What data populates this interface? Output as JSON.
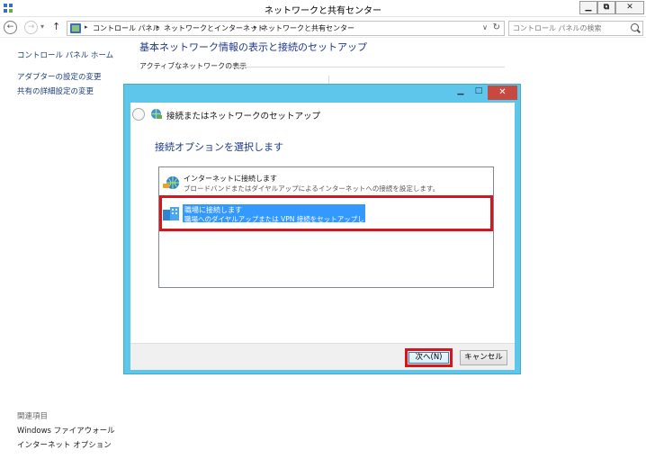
{
  "window": {
    "title": "ネットワークと共有センター",
    "min_glyph": "▁",
    "max_glyph": "⧉",
    "close_glyph": "✕"
  },
  "address": {
    "back_glyph": "←",
    "fwd_glyph": "→",
    "drop_glyph": "▾",
    "up_glyph": "↑",
    "breadcrumbs": [
      "コントロール パネル",
      "ネットワークとインターネット",
      "ネットワークと共有センター"
    ],
    "sep_glyph": "▸",
    "dropdown_glyph": "∨",
    "refresh_glyph": "↻",
    "search_placeholder": "コントロール パネルの検索"
  },
  "left_nav": {
    "home": "コントロール パネル ホーム",
    "items": [
      "アダプターの設定の変更",
      "共有の詳細設定の変更"
    ],
    "related_heading": "関連項目",
    "related_items": [
      "Windows ファイアウォール",
      "インターネット オプション"
    ]
  },
  "main": {
    "title": "基本ネットワーク情報の表示と接続のセットアップ",
    "active_networks_label": "アクティブなネットワークの表示"
  },
  "dialog": {
    "title": "接続またはネットワークのセットアップ",
    "min_glyph": "▁",
    "max_glyph": "□",
    "close_glyph": "✕",
    "heading": "接続オプションを選択します",
    "options": [
      {
        "title": "インターネットに接続します",
        "description": "ブロードバンドまたはダイヤルアップによるインターネットへの接続を設定します。",
        "icon": "globe-network-icon",
        "selected": false
      },
      {
        "title": "職場に接続します",
        "description": "職場へのダイヤルアップまたは VPN 接続をセットアップします。",
        "icon": "workplace-vpn-icon",
        "selected": true
      }
    ],
    "next_button": "次へ(N)",
    "cancel_button": "キャンセル"
  },
  "colors": {
    "dialog_frame": "#5ec6ea",
    "selection": "#3399ff",
    "annotation_red": "#d4161d",
    "link_blue": "#1d3a8a"
  }
}
